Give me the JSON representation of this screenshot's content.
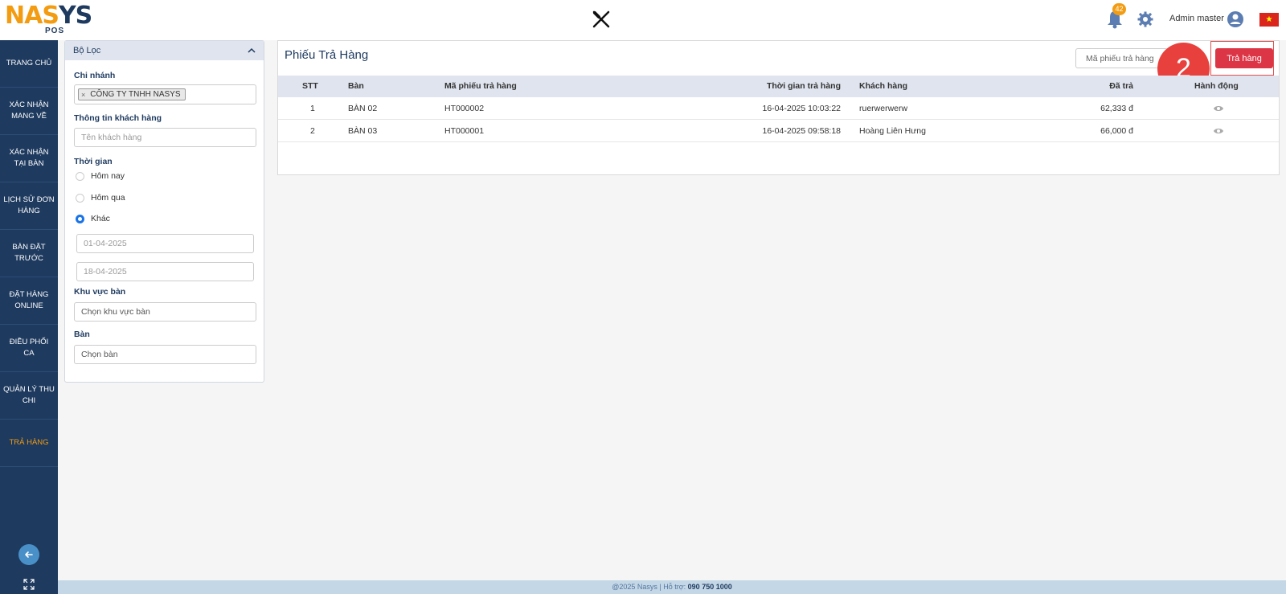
{
  "header": {
    "logo": {
      "text_a": "NA",
      "text_b": "S",
      "text_c": "YS",
      "sub": "POS"
    },
    "notifications_count": "42",
    "user_name": "Admin master"
  },
  "sidebar": {
    "items": [
      {
        "label": "TRANG CHỦ"
      },
      {
        "label": "XÁC NHẬN MANG VỀ"
      },
      {
        "label": "XÁC NHẬN TẠI BÀN"
      },
      {
        "label": "LỊCH SỬ ĐƠN HÀNG"
      },
      {
        "label": "BÀN ĐẶT TRƯỚC"
      },
      {
        "label": "ĐẶT HÀNG ONLINE"
      },
      {
        "label": "ĐIỀU PHỐI CA"
      },
      {
        "label": "QUẢN LÝ THU CHI"
      },
      {
        "label": "TRẢ HÀNG"
      }
    ],
    "active_index": 8
  },
  "filter": {
    "title": "Bộ Lọc",
    "branch_label": "Chi nhánh",
    "branch_chip": "CÔNG TY TNHH NASYS",
    "customer_label": "Thông tin khách hàng",
    "customer_placeholder": "Tên khách hàng",
    "time_label": "Thời gian",
    "time_options": [
      "Hôm nay",
      "Hôm qua",
      "Khác"
    ],
    "time_selected": "Khác",
    "date_from": "01-04-2025",
    "date_to": "18-04-2025",
    "area_label": "Khu vực bàn",
    "area_placeholder": "Chọn khu vực bàn",
    "table_label": "Bàn",
    "table_placeholder": "Chọn bàn"
  },
  "main": {
    "title": "Phiếu Trả Hàng",
    "search_placeholder": "Mã phiếu trả hàng",
    "step_number": "2",
    "return_button": "Trả hàng",
    "columns": [
      "STT",
      "Bàn",
      "Mã phiếu trả hàng",
      "Thời gian trả hàng",
      "Khách hàng",
      "Đã trả",
      "Hành động"
    ],
    "rows": [
      {
        "stt": "1",
        "ban": "BÀN 02",
        "code": "HT000002",
        "time": "16-04-2025 10:03:22",
        "customer": "ruerwerwerw",
        "paid": "62,333 đ"
      },
      {
        "stt": "2",
        "ban": "BÀN 03",
        "code": "HT000001",
        "time": "16-04-2025 09:58:18",
        "customer": "Hoàng Liên Hưng",
        "paid": "66,000 đ"
      }
    ]
  },
  "footer": {
    "text": "@2025 Nasys | Hỗ trợ: ",
    "phone": "090 750 1000"
  },
  "colors": {
    "sidebar": "#1e3a5f",
    "accent": "#f39c12",
    "danger": "#dc3545"
  }
}
